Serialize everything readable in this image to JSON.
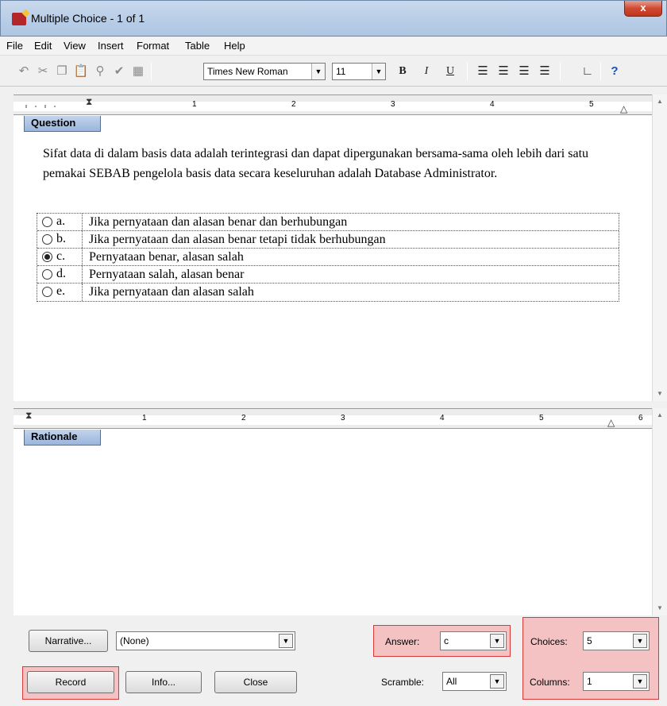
{
  "window": {
    "title": "Multiple Choice - 1 of 1",
    "close_glyph": "x"
  },
  "menu": [
    "File",
    "Edit",
    "View",
    "Insert",
    "Format",
    "Table",
    "Help"
  ],
  "toolbar": {
    "font_name": "Times New Roman",
    "font_size": "11",
    "bold": "B",
    "italic": "I",
    "underline": "U",
    "help": "?"
  },
  "question": {
    "tab_label": "Question",
    "text": "Sifat data di dalam basis data adalah terintegrasi dan dapat dipergunakan bersama-sama oleh lebih dari satu pemakai SEBAB pengelola basis data secara keseluruhan adalah Database Administrator.",
    "choices": [
      {
        "letter": "a.",
        "text": "Jika pernyataan dan alasan benar dan berhubungan",
        "selected": false
      },
      {
        "letter": "b.",
        "text": "Jika pernyataan dan alasan benar tetapi tidak berhubungan",
        "selected": false
      },
      {
        "letter": "c.",
        "text": "Pernyataan benar, alasan salah",
        "selected": true
      },
      {
        "letter": "d.",
        "text": "Pernyataan salah, alasan benar",
        "selected": false
      },
      {
        "letter": "e.",
        "text": "Jika pernyataan dan alasan salah",
        "selected": false
      }
    ]
  },
  "ruler_top_numbers": [
    "1",
    "2",
    "3",
    "4",
    "5"
  ],
  "ruler_bottom_numbers": [
    "1",
    "2",
    "3",
    "4",
    "5",
    "6"
  ],
  "rationale": {
    "tab_label": "Rationale"
  },
  "bottom": {
    "narrative_label": "Narrative...",
    "narrative_value": "(None)",
    "answer_label": "Answer:",
    "answer_value": "c",
    "scramble_label": "Scramble:",
    "scramble_value": "All",
    "choices_label": "Choices:",
    "choices_value": "5",
    "columns_label": "Columns:",
    "columns_value": "1",
    "record_label": "Record",
    "info_label": "Info...",
    "close_label": "Close"
  }
}
